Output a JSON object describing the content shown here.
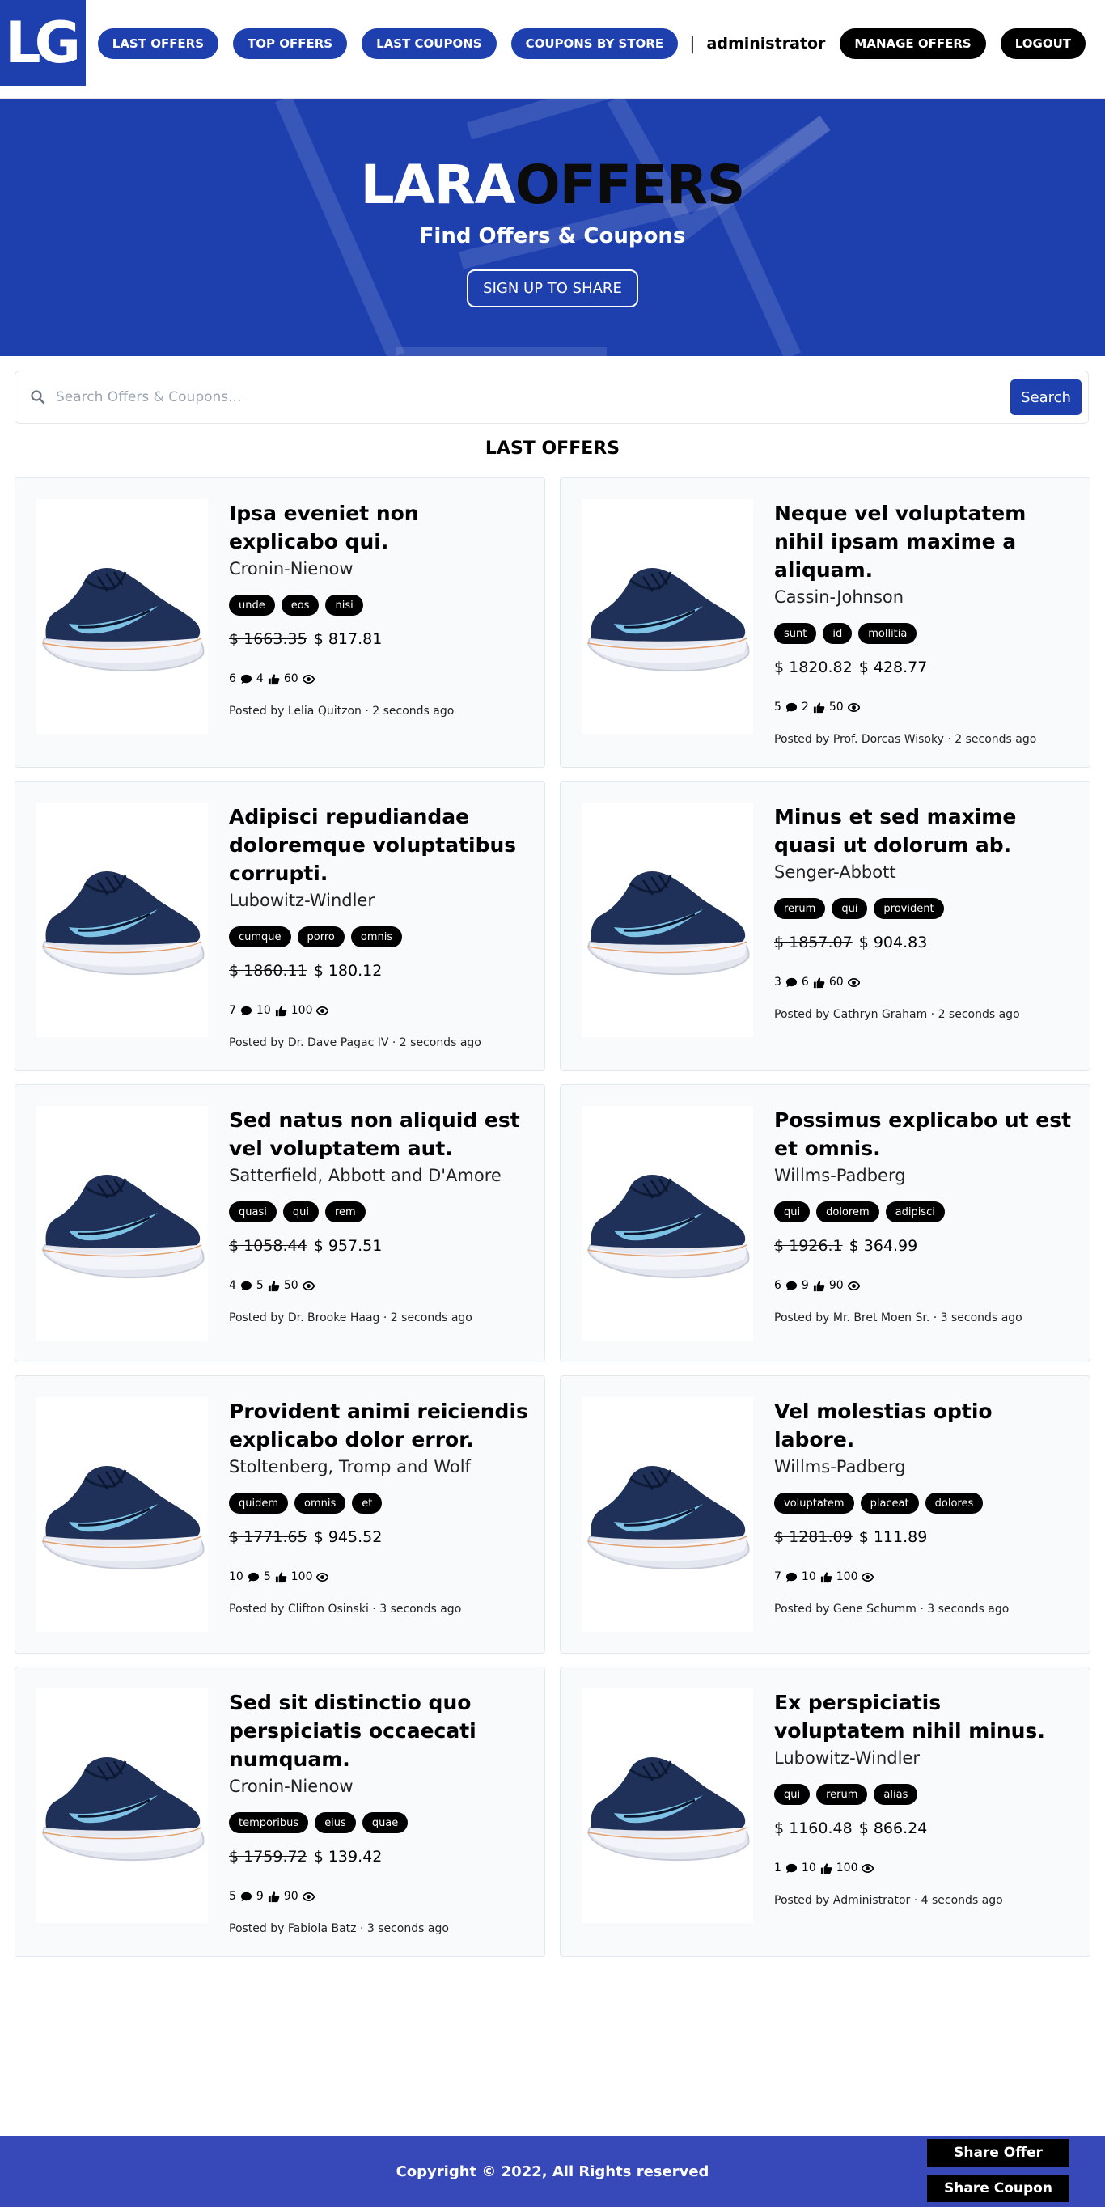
{
  "logo": "LG",
  "nav": {
    "items": [
      "LAST OFFERS",
      "TOP OFFERS",
      "LAST COUPONS",
      "COUPONS BY STORE"
    ],
    "separator": "|",
    "user": "administrator",
    "manage": "MANAGE OFFERS",
    "logout": "LOGOUT"
  },
  "hero": {
    "title_part1": "LARA",
    "title_part2": "OFFERS",
    "subtitle": "Find Offers & Coupons",
    "signup": "SIGN UP TO SHARE"
  },
  "search": {
    "placeholder": "Search Offers & Coupons...",
    "button": "Search"
  },
  "section_title": "LAST OFFERS",
  "offers": [
    {
      "title": "Ipsa eveniet non explicabo qui.",
      "store": "Cronin-Nienow",
      "tags": [
        "unde",
        "eos",
        "nisi"
      ],
      "old_price": "$ 1663.35",
      "new_price": "$ 817.81",
      "comments": "6",
      "likes": "4",
      "views": "60",
      "posted": "Posted by Lelia Quitzon · 2 seconds ago"
    },
    {
      "title": "Neque vel voluptatem nihil ipsam maxime a aliquam.",
      "store": "Cassin-Johnson",
      "tags": [
        "sunt",
        "id",
        "mollitia"
      ],
      "old_price": "$ 1820.82",
      "new_price": "$ 428.77",
      "comments": "5",
      "likes": "2",
      "views": "50",
      "posted": "Posted by Prof. Dorcas Wisoky · 2 seconds ago"
    },
    {
      "title": "Adipisci repudiandae doloremque voluptatibus corrupti.",
      "store": "Lubowitz-Windler",
      "tags": [
        "cumque",
        "porro",
        "omnis"
      ],
      "old_price": "$ 1860.11",
      "new_price": "$ 180.12",
      "comments": "7",
      "likes": "10",
      "views": "100",
      "posted": "Posted by Dr. Dave Pagac IV · 2 seconds ago"
    },
    {
      "title": "Minus et sed maxime quasi ut dolorum ab.",
      "store": "Senger-Abbott",
      "tags": [
        "rerum",
        "qui",
        "provident"
      ],
      "old_price": "$ 1857.07",
      "new_price": "$ 904.83",
      "comments": "3",
      "likes": "6",
      "views": "60",
      "posted": "Posted by Cathryn Graham · 2 seconds ago"
    },
    {
      "title": "Sed natus non aliquid est vel voluptatem aut.",
      "store": "Satterfield, Abbott and D'Amore",
      "tags": [
        "quasi",
        "qui",
        "rem"
      ],
      "old_price": "$ 1058.44",
      "new_price": "$ 957.51",
      "comments": "4",
      "likes": "5",
      "views": "50",
      "posted": "Posted by Dr. Brooke Haag · 2 seconds ago"
    },
    {
      "title": "Possimus explicabo ut est et omnis.",
      "store": "Willms-Padberg",
      "tags": [
        "qui",
        "dolorem",
        "adipisci"
      ],
      "old_price": "$ 1926.1",
      "new_price": "$ 364.99",
      "comments": "6",
      "likes": "9",
      "views": "90",
      "posted": "Posted by Mr. Bret Moen Sr. · 3 seconds ago"
    },
    {
      "title": "Provident animi reiciendis explicabo dolor error.",
      "store": "Stoltenberg, Tromp and Wolf",
      "tags": [
        "quidem",
        "omnis",
        "et"
      ],
      "old_price": "$ 1771.65",
      "new_price": "$ 945.52",
      "comments": "10",
      "likes": "5",
      "views": "100",
      "posted": "Posted by Clifton Osinski · 3 seconds ago"
    },
    {
      "title": "Vel molestias optio labore.",
      "store": "Willms-Padberg",
      "tags": [
        "voluptatem",
        "placeat",
        "dolores"
      ],
      "old_price": "$ 1281.09",
      "new_price": "$ 111.89",
      "comments": "7",
      "likes": "10",
      "views": "100",
      "posted": "Posted by Gene Schumm · 3 seconds ago"
    },
    {
      "title": "Sed sit distinctio quo perspiciatis occaecati numquam.",
      "store": "Cronin-Nienow",
      "tags": [
        "temporibus",
        "eius",
        "quae"
      ],
      "old_price": "$ 1759.72",
      "new_price": "$ 139.42",
      "comments": "5",
      "likes": "9",
      "views": "90",
      "posted": "Posted by Fabiola Batz · 3 seconds ago"
    },
    {
      "title": "Ex perspiciatis voluptatem nihil minus.",
      "store": "Lubowitz-Windler",
      "tags": [
        "qui",
        "rerum",
        "alias"
      ],
      "old_price": "$ 1160.48",
      "new_price": "$ 866.24",
      "comments": "1",
      "likes": "10",
      "views": "100",
      "posted": "Posted by Administrator · 4 seconds ago"
    }
  ],
  "footer": {
    "copyright": "Copyright © 2022, All Rights reserved",
    "share_offer": "Share Offer",
    "share_coupon": "Share Coupon"
  }
}
